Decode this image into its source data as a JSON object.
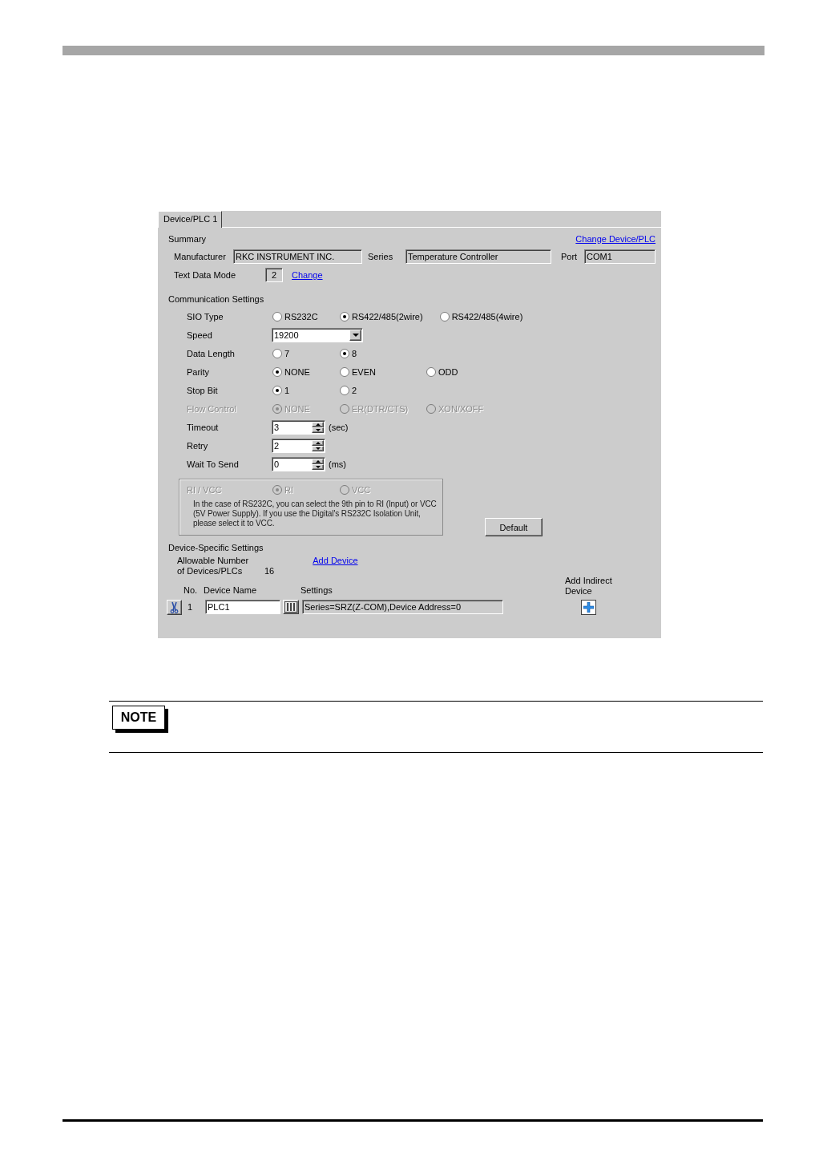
{
  "dialog": {
    "tabs": [
      {
        "label": "Device/PLC 1",
        "selected": true
      }
    ],
    "summary": {
      "title": "Summary",
      "change_device_link": "Change Device/PLC",
      "fields": [
        {
          "label": "Manufacturer",
          "value": "RKC INSTRUMENT INC."
        },
        {
          "label": "Series",
          "value": "Temperature Controller"
        },
        {
          "label": "Port",
          "value": "COM1"
        }
      ],
      "text_data_mode": {
        "label": "Text Data Mode",
        "value": "2",
        "link": "Change"
      }
    },
    "communication_settings": {
      "title": "Communication Settings",
      "rows": [
        {
          "kind": "radio",
          "label": "SIO Type",
          "disabled": false,
          "options": [
            {
              "label": "RS232C",
              "selected": false
            },
            {
              "label": "RS422/485(2wire)",
              "selected": true
            },
            {
              "label": "RS422/485(4wire)",
              "selected": false
            }
          ]
        },
        {
          "kind": "dropdown",
          "label": "Speed",
          "value": "19200"
        },
        {
          "kind": "radio",
          "label": "Data Length",
          "disabled": false,
          "options": [
            {
              "label": "7",
              "selected": false
            },
            {
              "label": "8",
              "selected": true
            }
          ]
        },
        {
          "kind": "radio",
          "label": "Parity",
          "disabled": false,
          "options": [
            {
              "label": "NONE",
              "selected": true
            },
            {
              "label": "EVEN",
              "selected": false
            },
            {
              "label": "ODD",
              "selected": false
            }
          ]
        },
        {
          "kind": "radio",
          "label": "Stop Bit",
          "disabled": false,
          "options": [
            {
              "label": "1",
              "selected": true
            },
            {
              "label": "2",
              "selected": false
            }
          ]
        },
        {
          "kind": "radio",
          "label": "Flow Control",
          "disabled": true,
          "options": [
            {
              "label": "NONE",
              "selected": true
            },
            {
              "label": "ER(DTR/CTS)",
              "selected": false
            },
            {
              "label": "XON/XOFF",
              "selected": false
            }
          ]
        },
        {
          "kind": "spin",
          "label": "Timeout",
          "value": "3",
          "unit": "(sec)"
        },
        {
          "kind": "spin",
          "label": "Retry",
          "value": "2"
        },
        {
          "kind": "spin",
          "label": "Wait To Send",
          "value": "0",
          "unit": "(ms)"
        }
      ],
      "ri_vcc": {
        "label": "RI / VCC",
        "disabled": true,
        "options": [
          {
            "label": "RI",
            "selected": true
          },
          {
            "label": "VCC",
            "selected": false
          }
        ],
        "note": "In the case of RS232C, you can select the 9th pin to RI (Input) or VCC (5V Power Supply). If you use the Digital's RS232C Isolation Unit, please select it to VCC."
      },
      "default_button": "Default"
    },
    "device_specific_settings": {
      "title": "Device-Specific Settings",
      "allowable_label": "Allowable Number of Devices/PLCs",
      "allowable_count": "16",
      "add_device_link": "Add Device",
      "columns": [
        "No.",
        "Device Name",
        "Settings",
        "Add Indirect Device"
      ],
      "rows": [
        {
          "no": "1",
          "device_name": "PLC1",
          "settings": "Series=SRZ(Z-COM),Device Address=0"
        }
      ]
    }
  },
  "note": {
    "label": "NOTE"
  }
}
